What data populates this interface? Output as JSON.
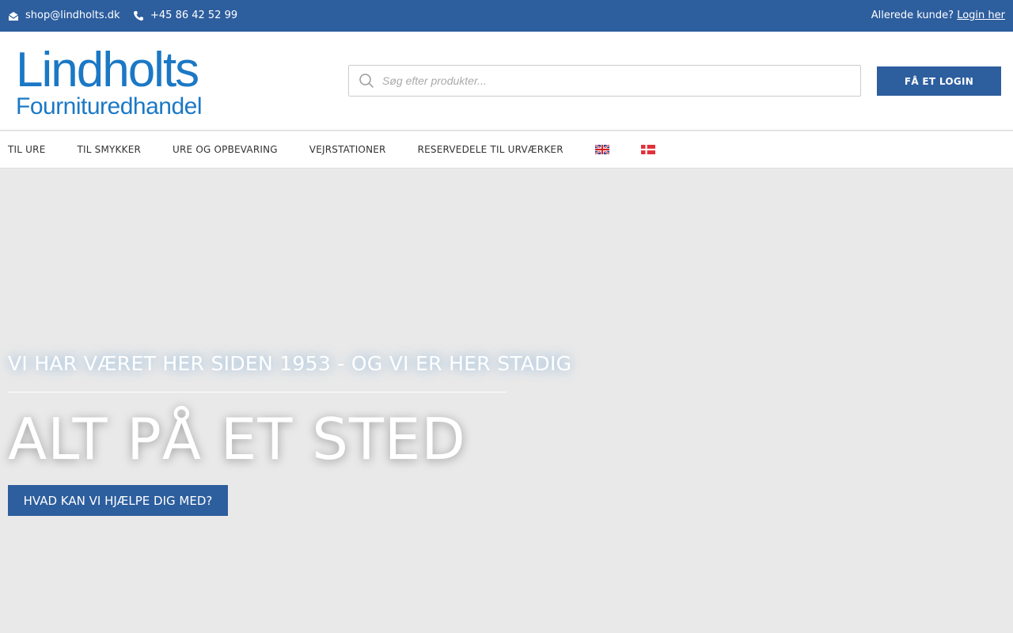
{
  "topbar": {
    "email": "shop@lindholts.dk",
    "phone": "+45 86 42 52 99",
    "login_prompt": "Allerede kunde?",
    "login_link": "Login her",
    "email_icon": "envelope-open-icon",
    "phone_icon": "phone-icon"
  },
  "header": {
    "logo_line1": "Lindholts",
    "logo_line2": "Fournituredhandel",
    "search_placeholder": "Søg efter produkter...",
    "login_button": "FÅ ET LOGIN"
  },
  "nav": {
    "items": [
      {
        "label": "TIL URE"
      },
      {
        "label": "TIL SMYKKER"
      },
      {
        "label": "URE OG OPBEVARING"
      },
      {
        "label": "VEJRSTATIONER"
      },
      {
        "label": "RESERVEDELE TIL URVÆRKER"
      }
    ],
    "flags": [
      "uk-flag-icon",
      "denmark-flag-icon"
    ]
  },
  "hero": {
    "subtitle": "VI HAR VÆRET HER SIDEN 1953 - OG VI ER HER STADIG",
    "headline": "ALT PÅ ET STED",
    "cta": "HVAD KAN VI HJÆLPE DIG MED?"
  },
  "colors": {
    "brand_blue": "#2d5e9e",
    "logo_blue": "#1b78c5",
    "hero_bg": "#e9e9e9"
  }
}
